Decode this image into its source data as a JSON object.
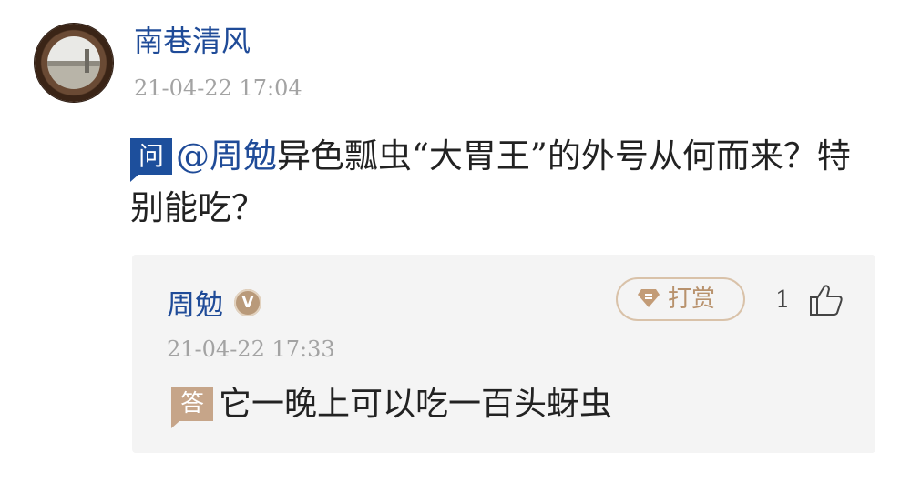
{
  "question": {
    "author": "南巷清风",
    "time": "21-04-22 17:04",
    "badge": "问",
    "mention": "@周勉",
    "text": "异色瓢虫“大胃王”的外号从何而来？特别能吃？"
  },
  "answer": {
    "author": "周勉",
    "verified_badge": "V",
    "tip_label": "打赏",
    "like_count": "1",
    "time": "21-04-22 17:33",
    "badge": "答",
    "text": "它一晚上可以吃一百头蚜虫"
  },
  "colors": {
    "link_blue": "#1f4b98",
    "question_badge": "#1d4f9c",
    "answer_badge": "#c6a589",
    "tip_gold": "#b8926d",
    "card_bg": "#f4f4f4"
  },
  "icons": {
    "tip": "gem-icon",
    "like": "thumbs-up-icon"
  }
}
